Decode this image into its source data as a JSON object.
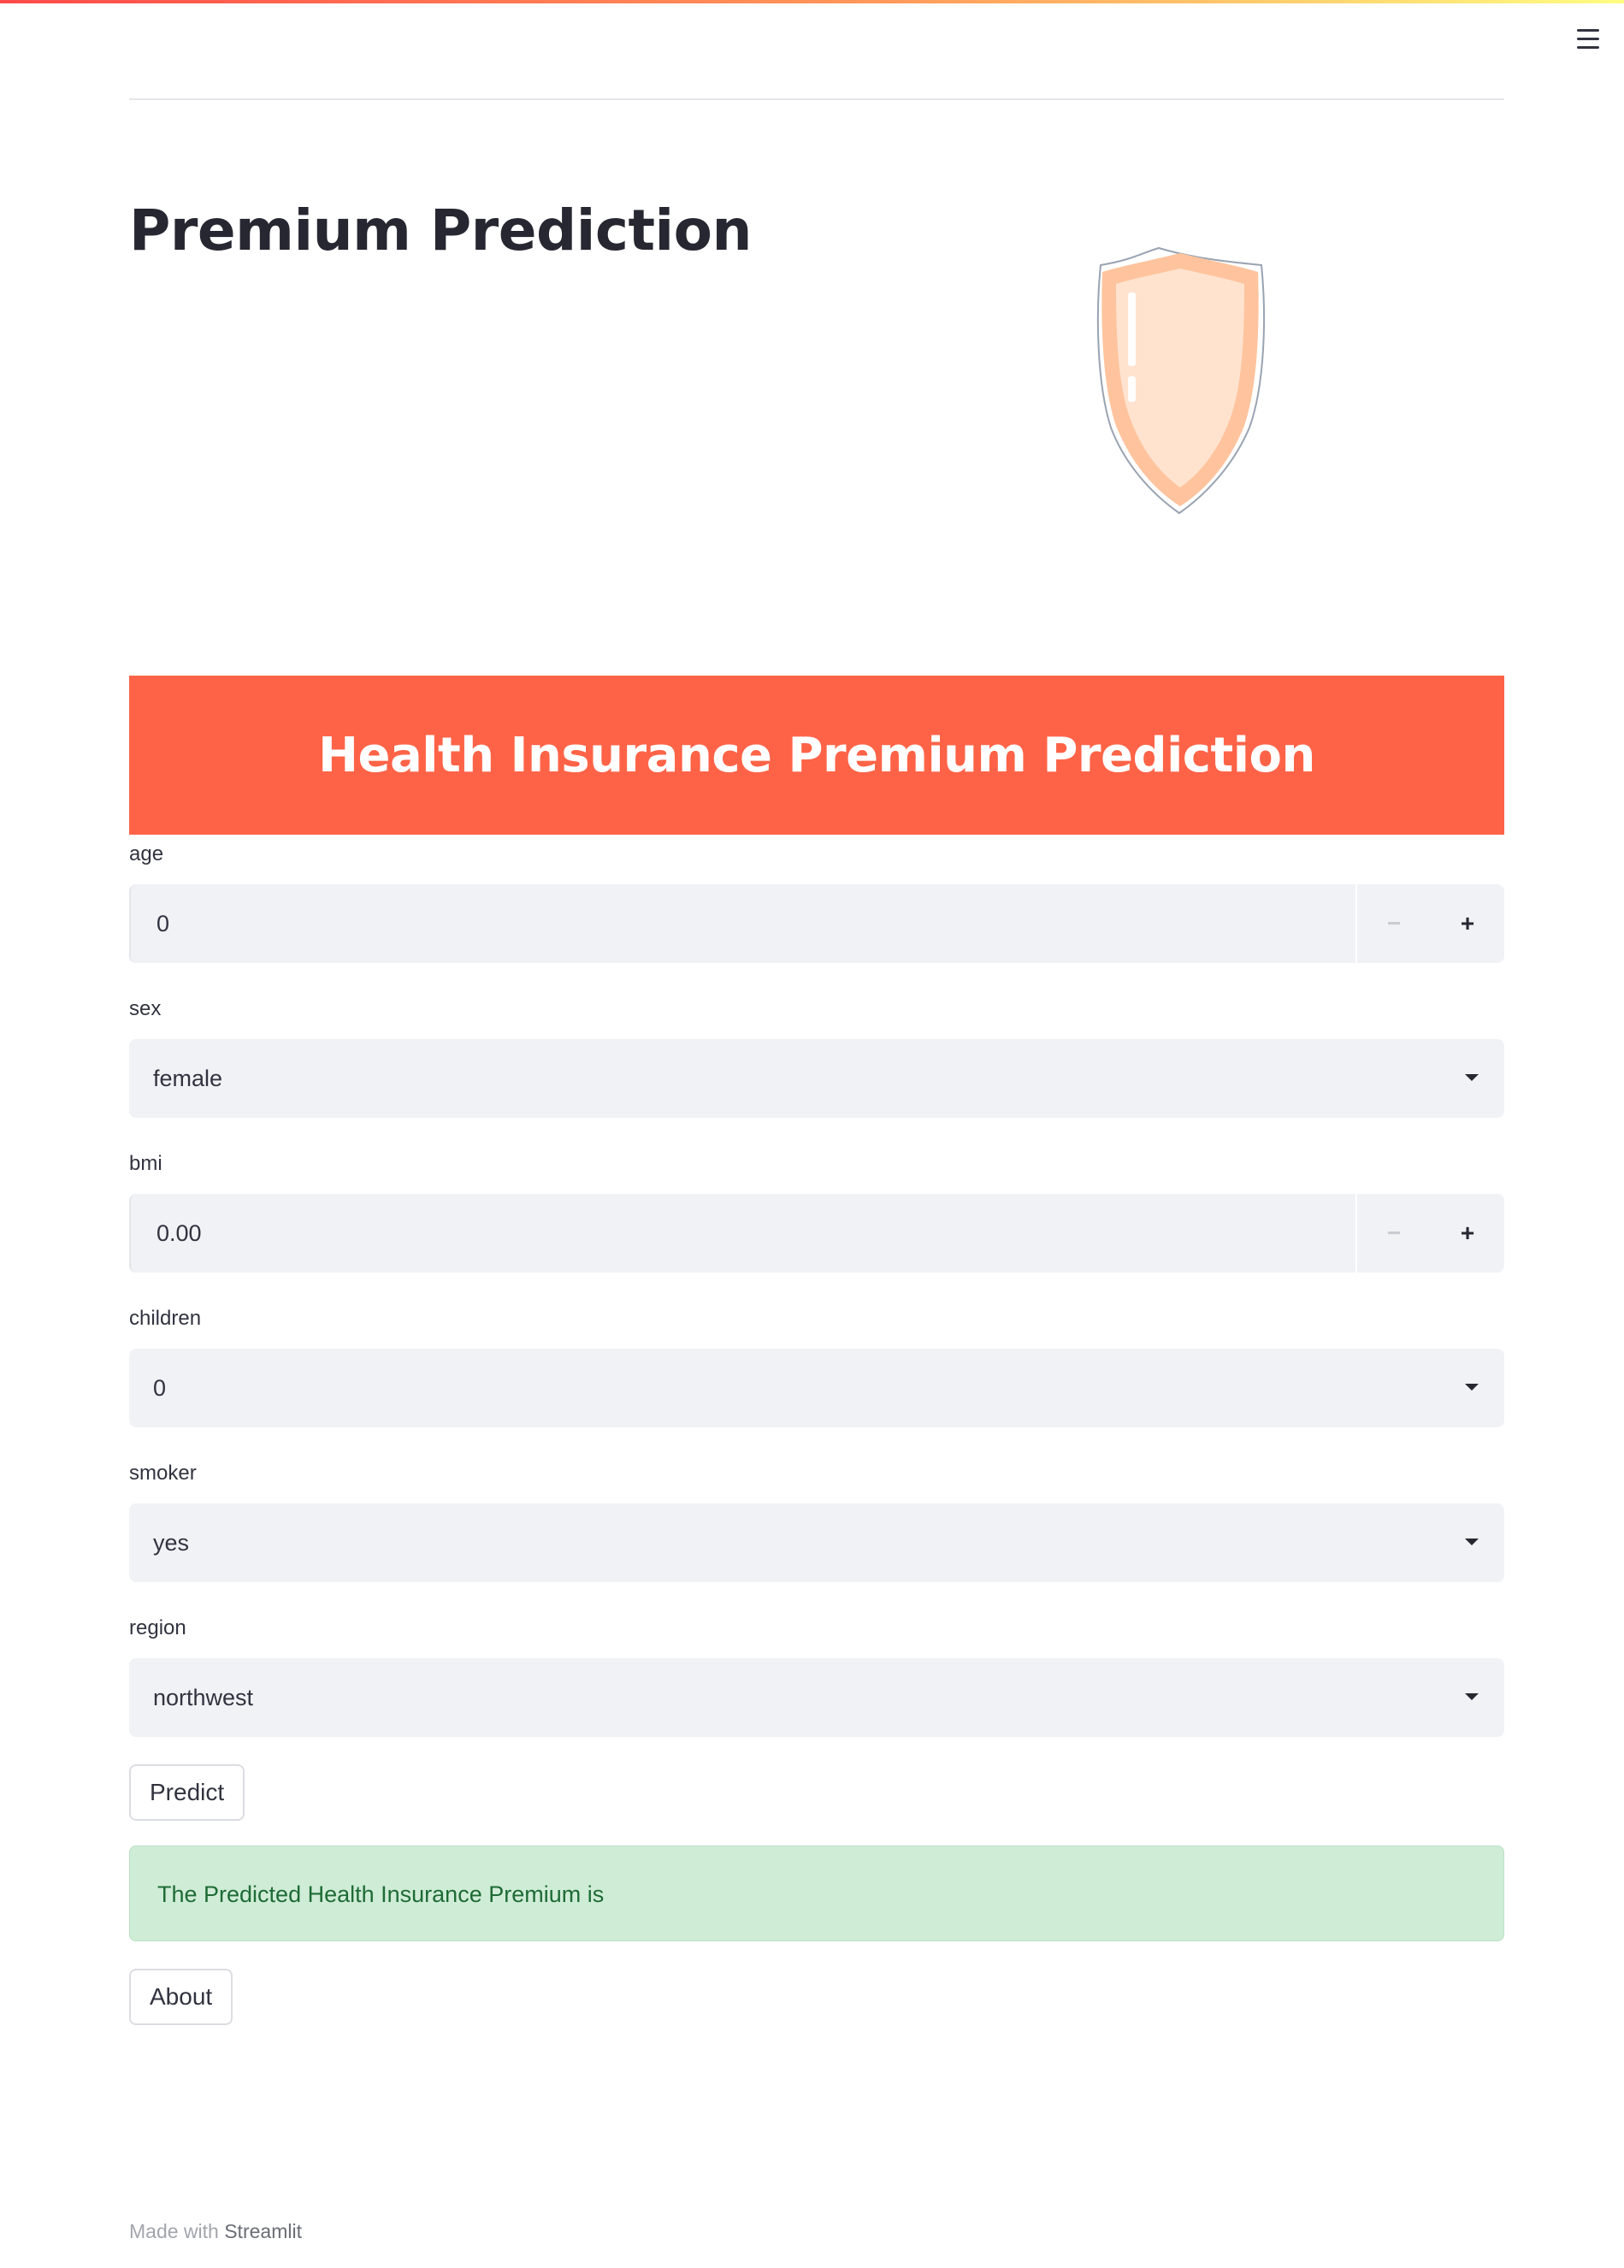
{
  "header": {
    "menu_icon": "hamburger-menu-icon"
  },
  "page": {
    "title": "Premium Prediction",
    "hero_icon": "shield-icon",
    "banner_text": "Health Insurance Premium Prediction"
  },
  "form": {
    "age": {
      "label": "age",
      "value": "0",
      "minus": "−",
      "plus": "+"
    },
    "sex": {
      "label": "sex",
      "value": "female"
    },
    "bmi": {
      "label": "bmi",
      "value": "0.00",
      "minus": "−",
      "plus": "+"
    },
    "children": {
      "label": "children",
      "value": "0"
    },
    "smoker": {
      "label": "smoker",
      "value": "yes"
    },
    "region": {
      "label": "region",
      "value": "northwest"
    }
  },
  "buttons": {
    "predict": "Predict",
    "about": "About"
  },
  "result": {
    "message": "The Predicted Health Insurance Premium is"
  },
  "footer": {
    "prefix": "Made with",
    "brand": "Streamlit"
  },
  "colors": {
    "banner": "#ff6347",
    "success_bg": "#cfecd6",
    "success_text": "#1e6b35",
    "shield_fill": "#ffe3cf",
    "shield_rim": "#ffc49e"
  }
}
